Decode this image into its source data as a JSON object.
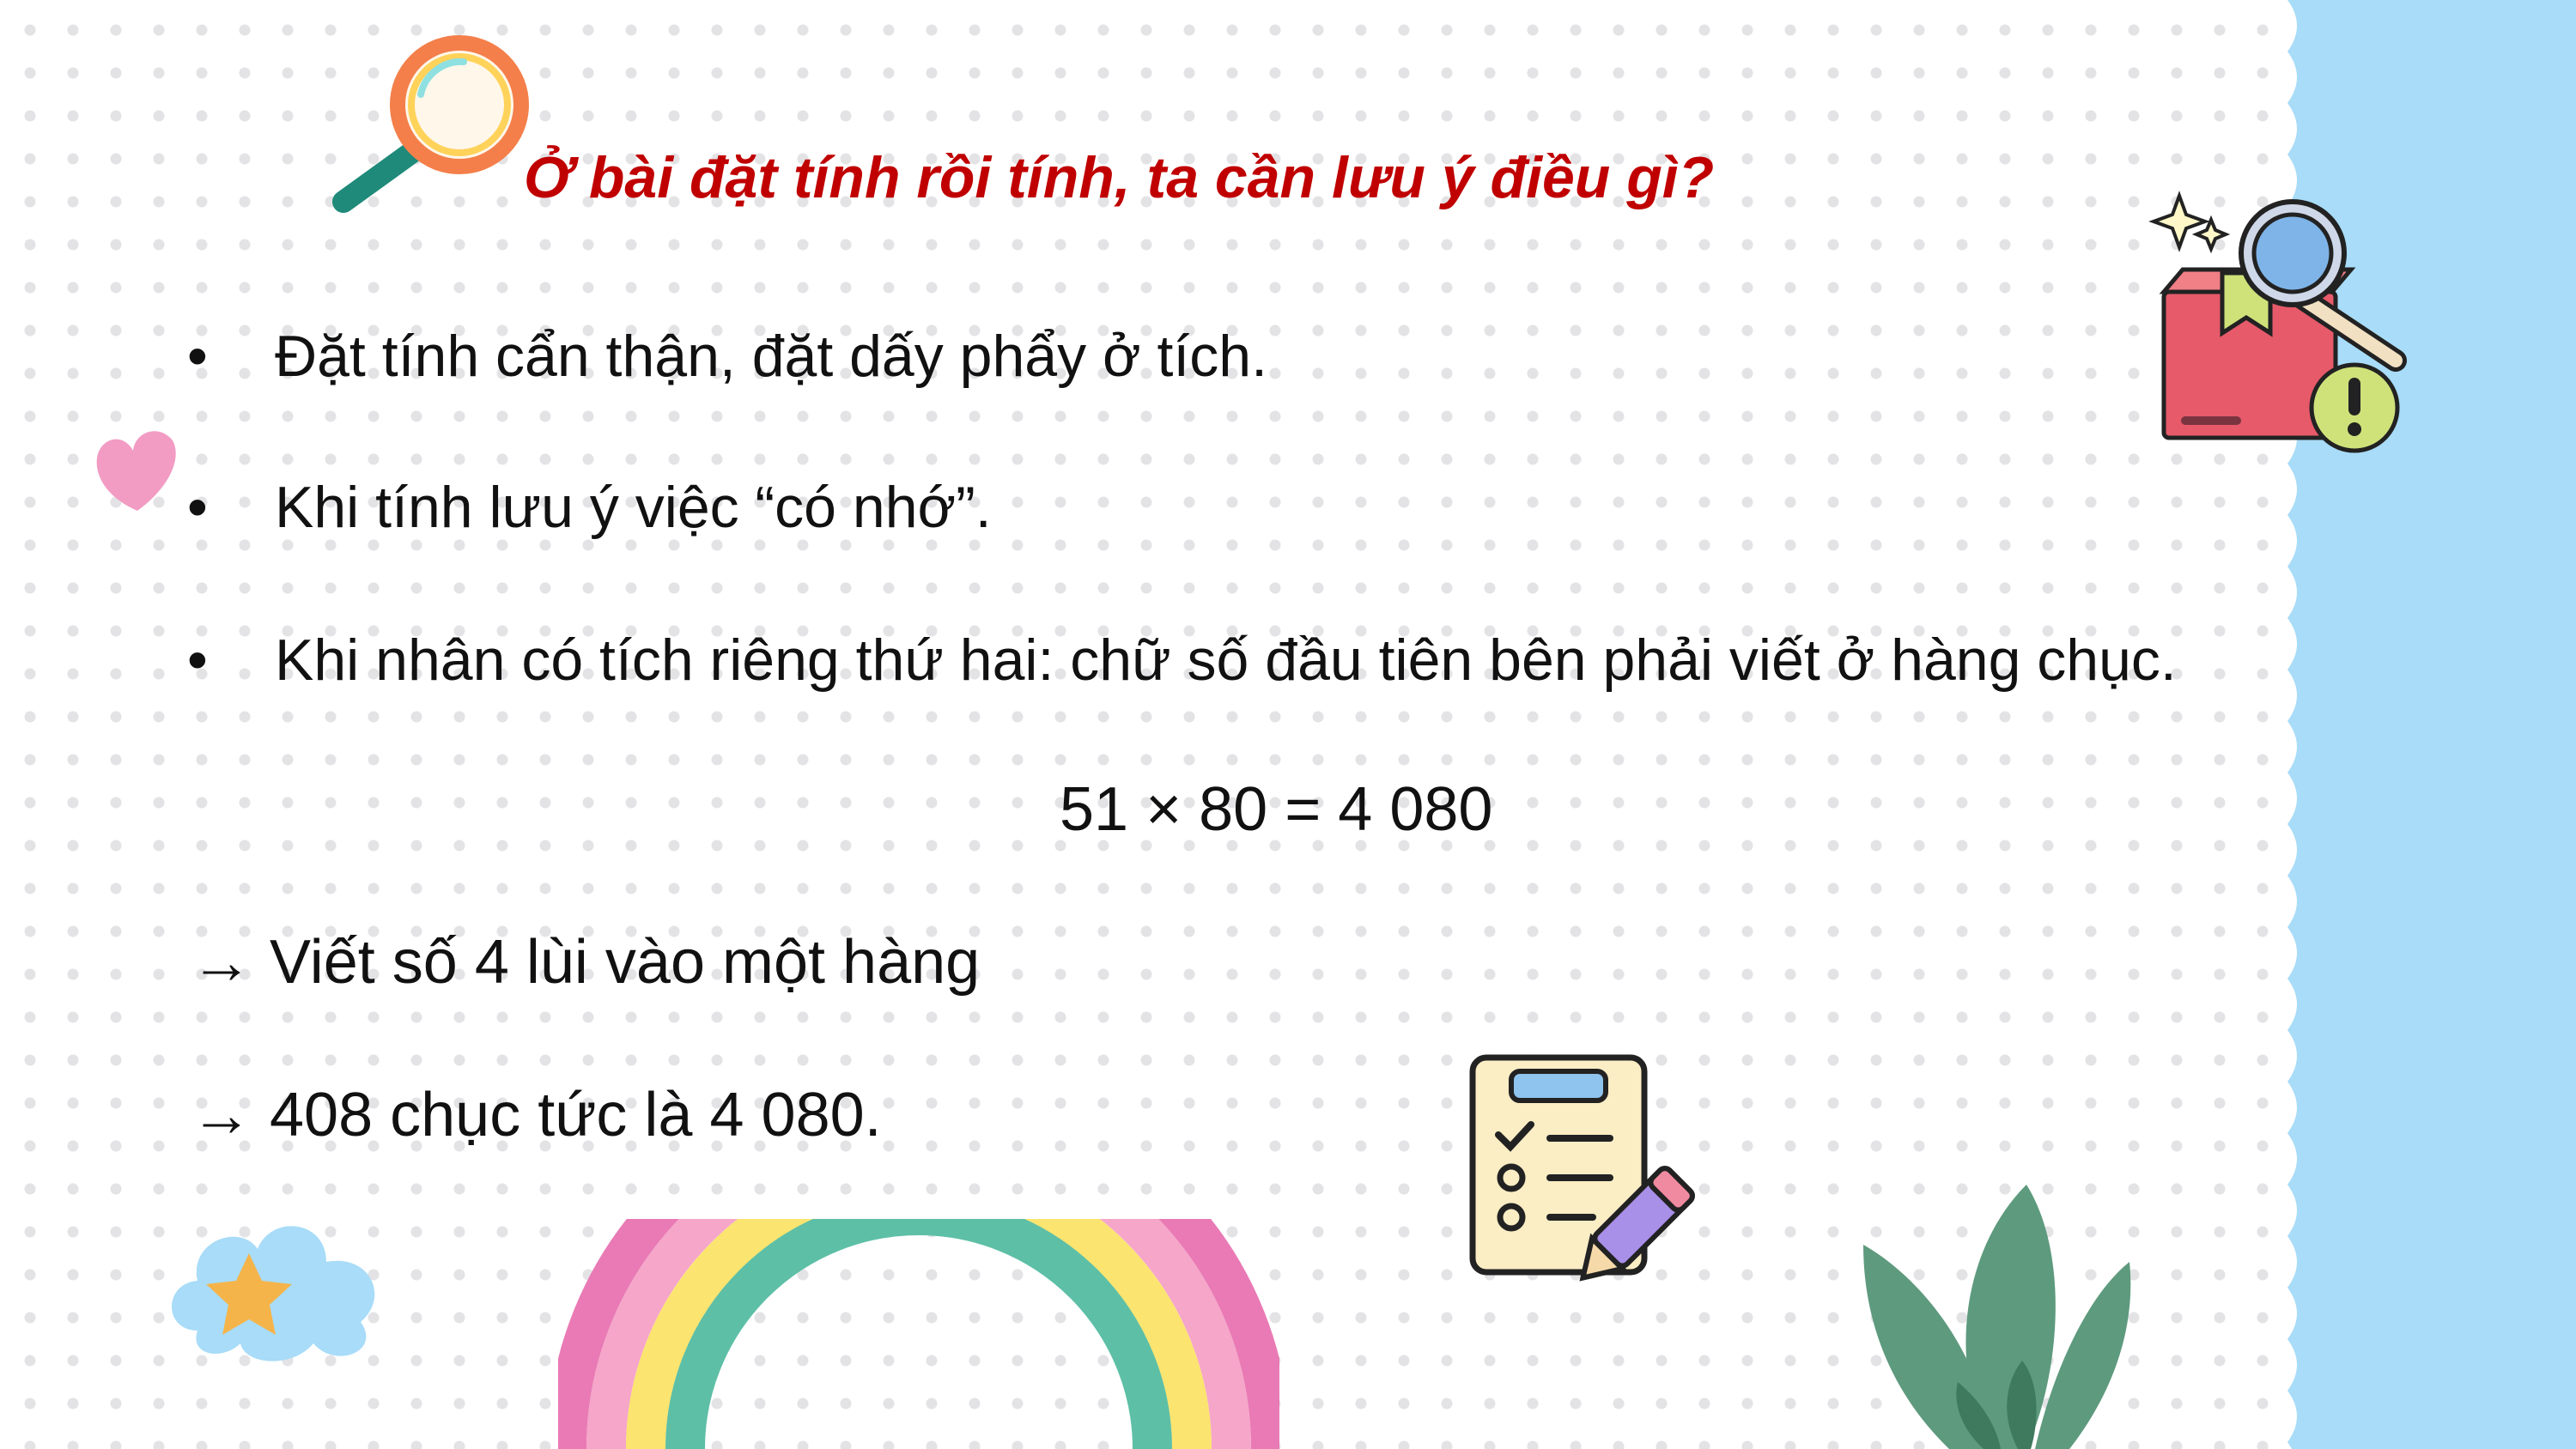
{
  "title": "Ở bài đặt tính rồi tính, ta cần lưu ý điều gì?",
  "bullets": [
    {
      "marker": "•",
      "text": "Đặt tính cẩn thận, đặt dấy phẩy ở tích."
    },
    {
      "marker": "•",
      "text": "Khi tính lưu ý việc “có nhớ”."
    },
    {
      "marker": "•",
      "text": "Khi nhân có tích riêng thứ hai: chữ số đầu tiên bên phải viết ở hàng chục."
    }
  ],
  "equation": "51 × 80 = 4 080",
  "notes": [
    "→ Viết số 4 lùi vào một hàng",
    "→ 408 chục tức là 4 080."
  ],
  "colors": {
    "title": "#c00000",
    "text": "#111111",
    "side_band": "#a8dcf8",
    "heart": "#f29cc4",
    "rainbow": [
      "#e97ab5",
      "#f5a6c9",
      "#fbe46f",
      "#5dbfa6"
    ],
    "plant": "#5e9a7e"
  },
  "icons": [
    "magnifier-icon",
    "heart-icon",
    "box-search-icon",
    "cloud-star-icon",
    "rainbow-icon",
    "checklist-icon",
    "plant-icon"
  ]
}
